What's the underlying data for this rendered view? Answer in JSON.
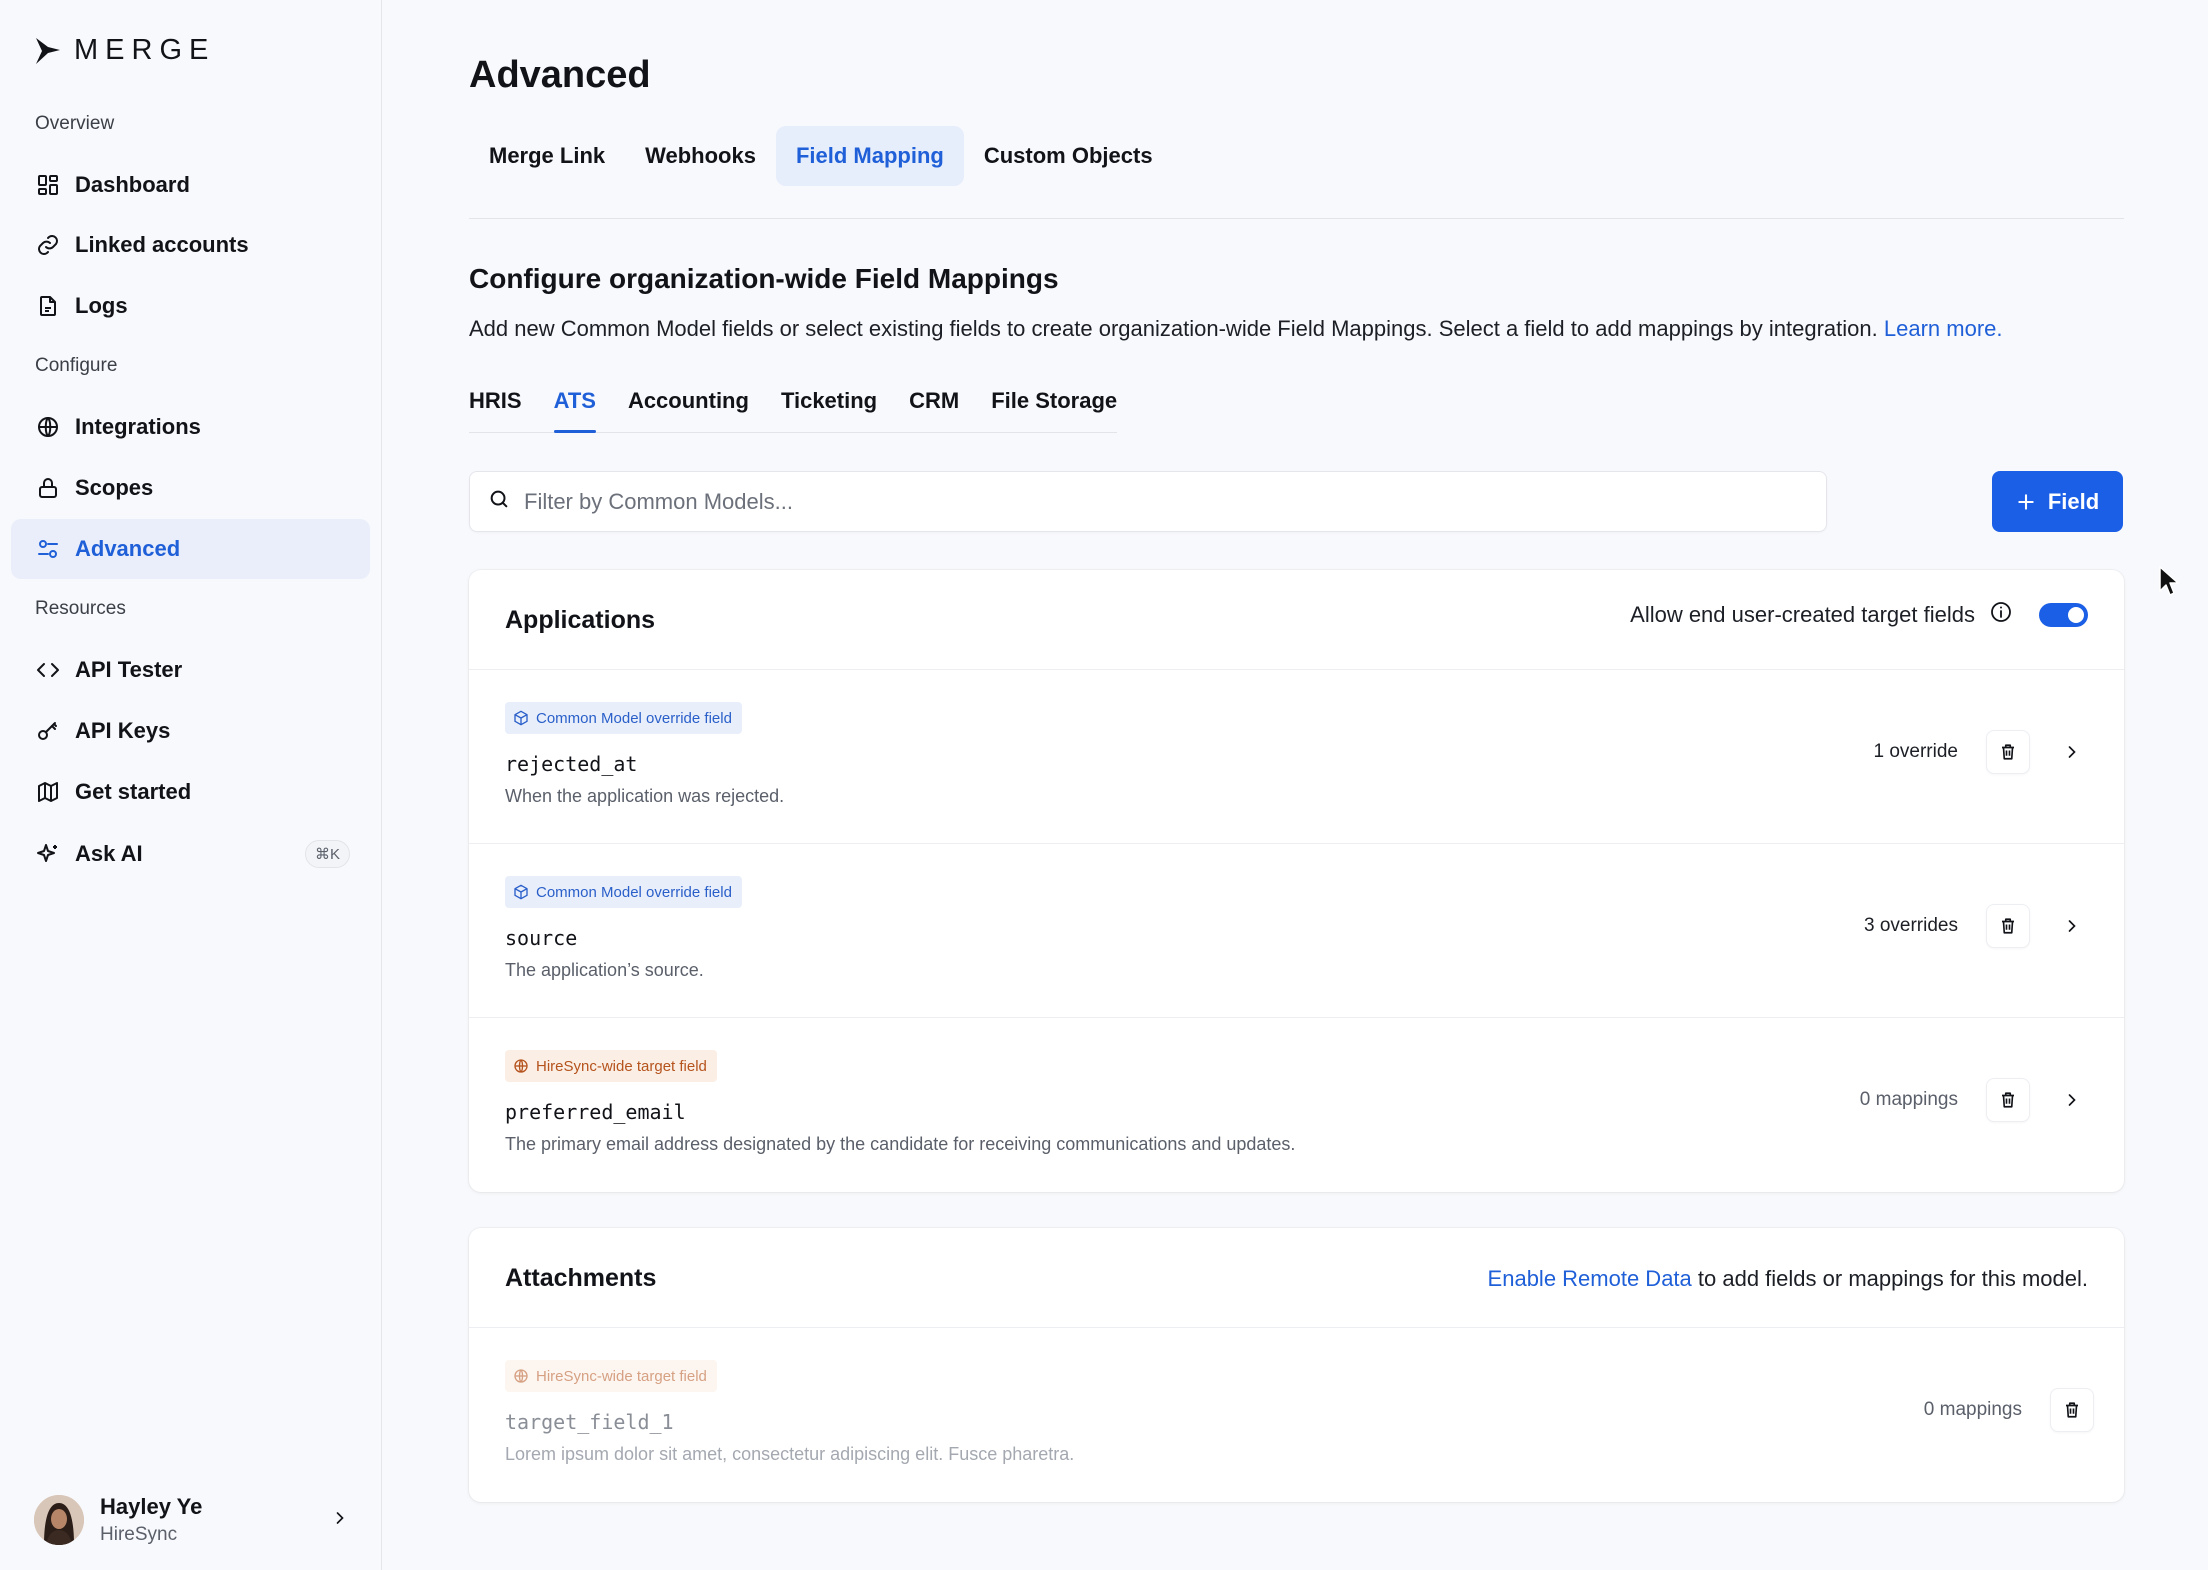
{
  "brand": {
    "name": "MERGE",
    "accent": "#1a5fe6"
  },
  "sidebar": {
    "sections": {
      "overview": "Overview",
      "configure": "Configure",
      "resources": "Resources"
    },
    "items": [
      {
        "label": "Dashboard",
        "icon": "dashboard-icon"
      },
      {
        "label": "Linked accounts",
        "icon": "link-icon"
      },
      {
        "label": "Logs",
        "icon": "logs-icon"
      },
      {
        "label": "Integrations",
        "icon": "globe-icon"
      },
      {
        "label": "Scopes",
        "icon": "lock-icon"
      },
      {
        "label": "Advanced",
        "icon": "sliders-icon",
        "active": true
      },
      {
        "label": "API Tester",
        "icon": "code-icon"
      },
      {
        "label": "API Keys",
        "icon": "key-icon"
      },
      {
        "label": "Get started",
        "icon": "map-icon"
      },
      {
        "label": "Ask AI",
        "icon": "sparkle-icon",
        "shortcut": "⌘K"
      }
    ],
    "user": {
      "name": "Hayley Ye",
      "org": "HireSync"
    }
  },
  "main": {
    "title": "Advanced",
    "tabs": [
      {
        "label": "Merge Link"
      },
      {
        "label": "Webhooks"
      },
      {
        "label": "Field Mapping",
        "active": true
      },
      {
        "label": "Custom Objects"
      }
    ],
    "config": {
      "title": "Configure organization-wide Field Mappings",
      "description": "Add new Common Model fields or select existing fields to create organization-wide Field Mappings. Select a field to add mappings by integration.",
      "learn_more": "Learn more."
    },
    "categories": [
      {
        "label": "HRIS"
      },
      {
        "label": "ATS",
        "active": true
      },
      {
        "label": "Accounting"
      },
      {
        "label": "Ticketing"
      },
      {
        "label": "CRM"
      },
      {
        "label": "File Storage"
      }
    ],
    "search": {
      "placeholder": "Filter by Common Models...",
      "value": ""
    },
    "add_field_label": "Field",
    "cards": {
      "applications": {
        "title": "Applications",
        "toggle_label": "Allow end user-created target fields",
        "toggle_on": true,
        "rows": [
          {
            "badge": "Common Model override field",
            "badge_type": "blue",
            "name": "rejected_at",
            "description": "When the application was rejected.",
            "count": "1 override"
          },
          {
            "badge": "Common Model override field",
            "badge_type": "blue",
            "name": "source",
            "description": "The application’s source.",
            "count": "3 overrides"
          },
          {
            "badge": "HireSync-wide target field",
            "badge_type": "orange",
            "name": "preferred_email",
            "description": "The primary email address designated by the candidate for receiving communications and updates.",
            "count": "0 mappings"
          }
        ]
      },
      "attachments": {
        "title": "Attachments",
        "enable_link": "Enable Remote Data",
        "enable_suffix": " to add fields or mappings for this model.",
        "rows": [
          {
            "badge": "HireSync-wide target field",
            "badge_type": "orange",
            "name": "target_field_1",
            "description": "Lorem ipsum dolor sit amet, consectetur adipiscing elit. Fusce pharetra.",
            "count": "0 mappings"
          }
        ]
      }
    }
  }
}
